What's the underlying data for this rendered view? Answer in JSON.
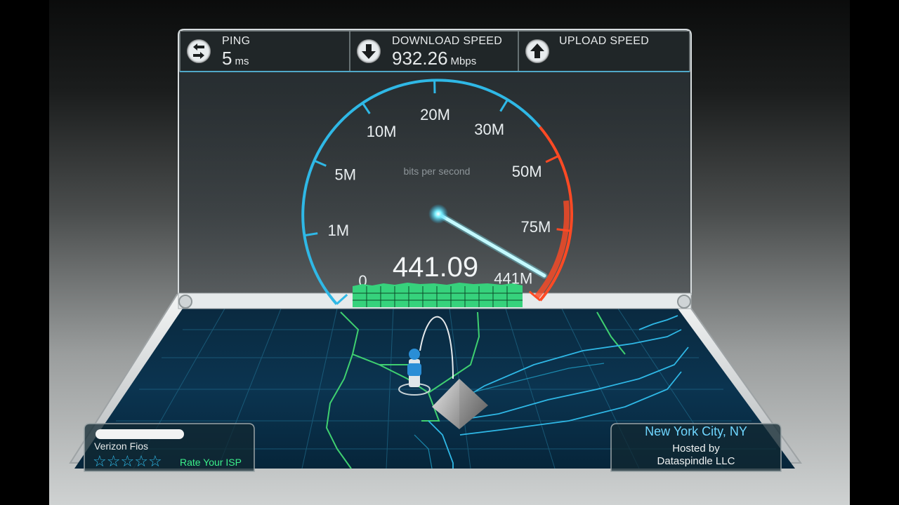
{
  "header": {
    "ping": {
      "label": "PING",
      "value": "5",
      "unit": "ms",
      "icon": "ping-arrows-icon"
    },
    "download": {
      "label": "DOWNLOAD SPEED",
      "value": "932.26",
      "unit": "Mbps",
      "icon": "download-arrow-icon"
    },
    "upload": {
      "label": "UPLOAD SPEED",
      "icon": "upload-arrow-icon"
    }
  },
  "gauge": {
    "scale_labels": [
      "0",
      "1M",
      "5M",
      "10M",
      "20M",
      "30M",
      "50M",
      "75M",
      "441M"
    ],
    "unit_caption": "bits per second",
    "current_reading": "441.09",
    "colors": {
      "scale": "#2fb8e6",
      "high": "#ff4a24",
      "needle": "#d9fbff",
      "graph": "#2fd87a"
    }
  },
  "isp": {
    "name": "Verizon Fios",
    "rate_label": "Rate Your ISP",
    "stars": 5
  },
  "server": {
    "city": "New York City, NY",
    "hosted_by": "Hosted by",
    "host_name": "Dataspindle LLC"
  }
}
